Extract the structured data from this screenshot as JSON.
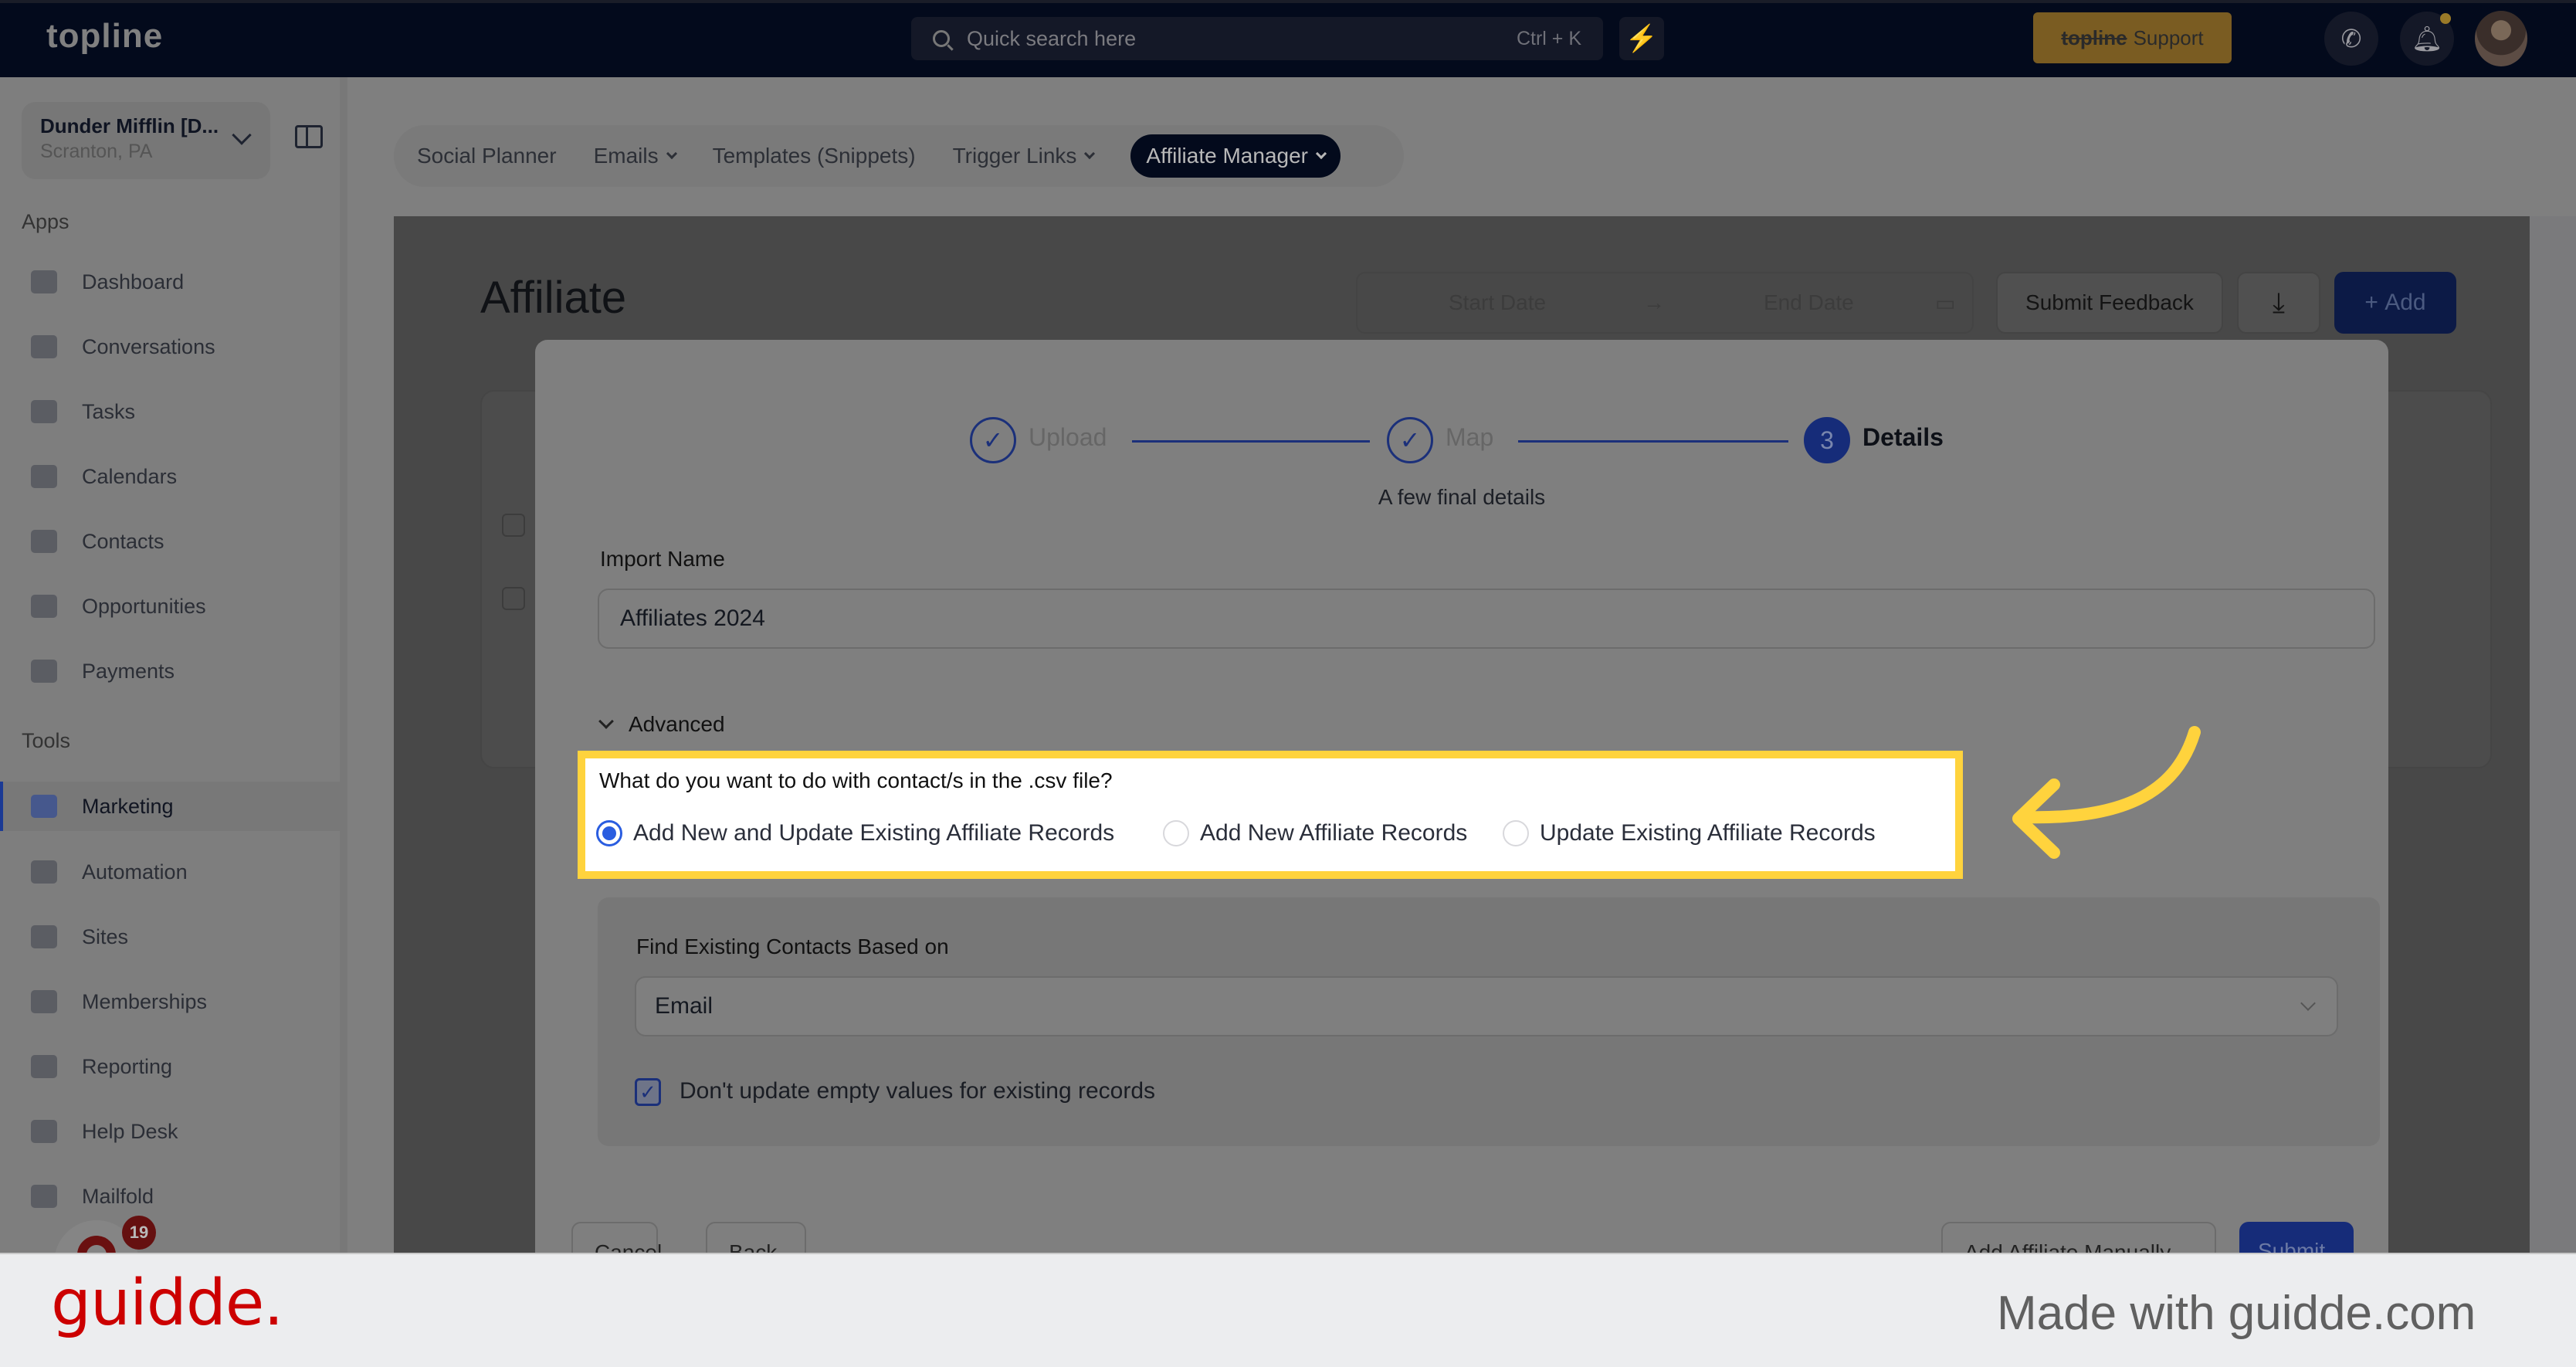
{
  "topbar": {
    "logo": "topline",
    "search_placeholder": "Quick search here",
    "search_shortcut": "Ctrl + K",
    "support_brand": "topline",
    "support_label": "Support"
  },
  "sidebar": {
    "account_name": "Dunder Mifflin [D...",
    "account_location": "Scranton, PA",
    "apps_heading": "Apps",
    "apps": [
      {
        "label": "Dashboard",
        "icon": "dashboard-icon"
      },
      {
        "label": "Conversations",
        "icon": "chat-icon"
      },
      {
        "label": "Tasks",
        "icon": "task-icon"
      },
      {
        "label": "Calendars",
        "icon": "calendar-icon"
      },
      {
        "label": "Contacts",
        "icon": "user-icon"
      },
      {
        "label": "Opportunities",
        "icon": "target-icon"
      },
      {
        "label": "Payments",
        "icon": "card-icon"
      }
    ],
    "tools_heading": "Tools",
    "tools": [
      {
        "label": "Marketing",
        "icon": "megaphone-icon",
        "active": true
      },
      {
        "label": "Automation",
        "icon": "gears-icon"
      },
      {
        "label": "Sites",
        "icon": "globe-icon"
      },
      {
        "label": "Memberships",
        "icon": "users-plus-icon"
      },
      {
        "label": "Reporting",
        "icon": "pie-chart-icon"
      },
      {
        "label": "Help Desk",
        "icon": "help-icon"
      },
      {
        "label": "Mailfold",
        "icon": "mail-icon"
      }
    ],
    "widget_badge": "19"
  },
  "subnav": {
    "tabs": [
      {
        "label": "Social Planner",
        "dropdown": false
      },
      {
        "label": "Emails",
        "dropdown": true
      },
      {
        "label": "Templates (Snippets)",
        "dropdown": false
      },
      {
        "label": "Trigger Links",
        "dropdown": true
      },
      {
        "label": "Affiliate Manager",
        "dropdown": true,
        "active": true
      }
    ]
  },
  "page": {
    "title": "Affiliate",
    "start_date_placeholder": "Start Date",
    "end_date_placeholder": "End Date",
    "submit_feedback": "Submit Feedback",
    "add_label": "Add"
  },
  "modal": {
    "steps": [
      {
        "label": "Upload",
        "state": "done"
      },
      {
        "label": "Map",
        "state": "done"
      },
      {
        "label": "Details",
        "state": "current",
        "number": "3"
      }
    ],
    "subtitle": "A few final details",
    "import_name_label": "Import Name",
    "import_name_value": "Affiliates 2024",
    "advanced_label": "Advanced",
    "question": "What do you want to do with contact/s in the .csv file?",
    "options": [
      {
        "label": "Add New and Update Existing Affiliate Records",
        "selected": true
      },
      {
        "label": "Add New Affiliate Records",
        "selected": false
      },
      {
        "label": "Update Existing Affiliate Records",
        "selected": false
      }
    ],
    "find_label": "Find Existing Contacts Based on",
    "find_value": "Email",
    "checkbox_label": "Don't update empty values for existing records",
    "checkbox_checked": true,
    "buttons": {
      "cancel": "Cancel",
      "back": "Back",
      "add_manually": "Add Affiliate Manually",
      "submit": "Submit"
    }
  },
  "annotation": {
    "highlight_color": "#ffd33d"
  },
  "footer": {
    "brand": "guidde.",
    "made_with": "Made with guidde.com"
  }
}
